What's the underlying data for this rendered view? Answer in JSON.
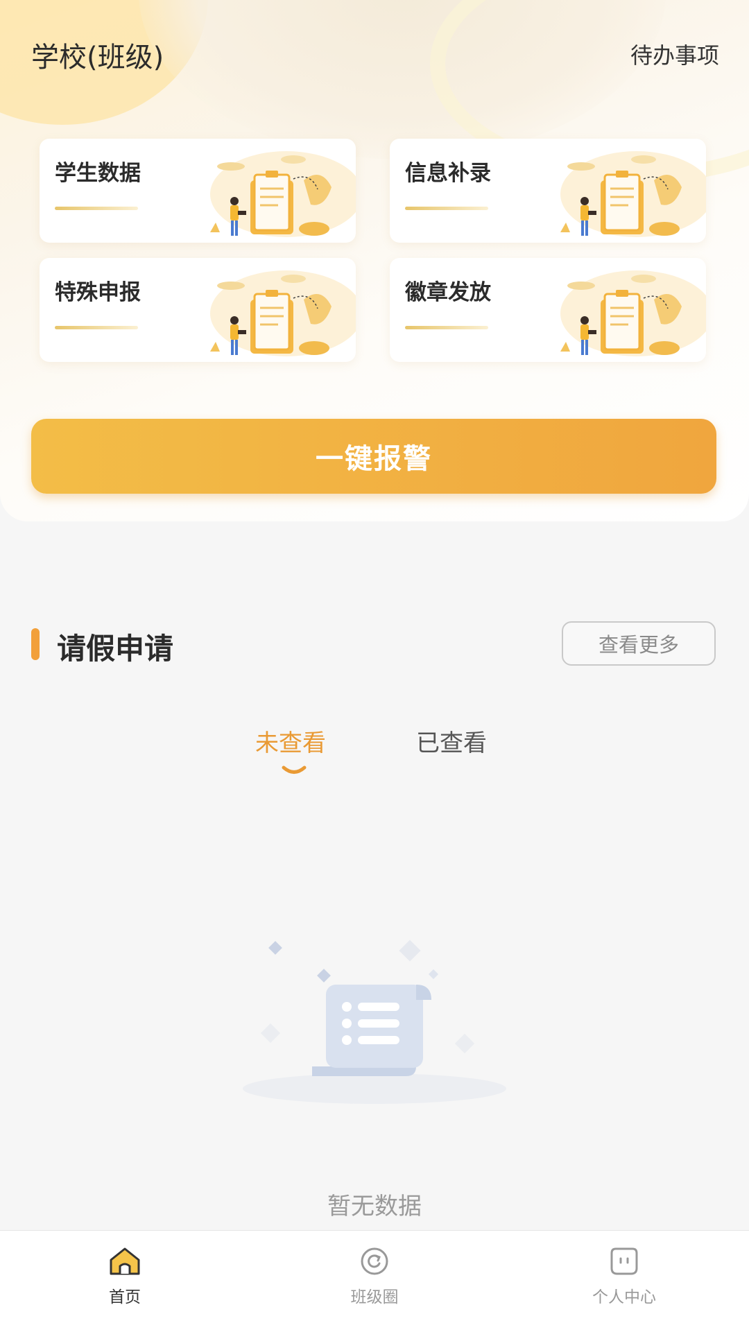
{
  "header": {
    "title": "学校(班级)",
    "todo_label": "待办事项"
  },
  "cards": [
    {
      "label": "学生数据",
      "art": "report-illustration"
    },
    {
      "label": "信息补录",
      "art": "report-illustration"
    },
    {
      "label": "特殊申报",
      "art": "report-illustration"
    },
    {
      "label": "徽章发放",
      "art": "report-illustration"
    }
  ],
  "alarm_button": {
    "label": "一键报警"
  },
  "leave_section": {
    "title": "请假申请",
    "more_label": "查看更多",
    "tabs": [
      {
        "label": "未查看",
        "active": true
      },
      {
        "label": "已查看",
        "active": false
      }
    ],
    "empty_text": "暂无数据"
  },
  "bottom_nav": {
    "items": [
      {
        "label": "首页",
        "icon": "home-icon",
        "active": true
      },
      {
        "label": "班级圈",
        "icon": "class-circle-icon",
        "active": false
      },
      {
        "label": "个人中心",
        "icon": "profile-icon",
        "active": false
      }
    ]
  },
  "colors": {
    "accent": "#f0a63e",
    "accent_light": "#f3bd47",
    "text_dark": "#2b2b2b",
    "text_muted": "#9a9a9a"
  }
}
